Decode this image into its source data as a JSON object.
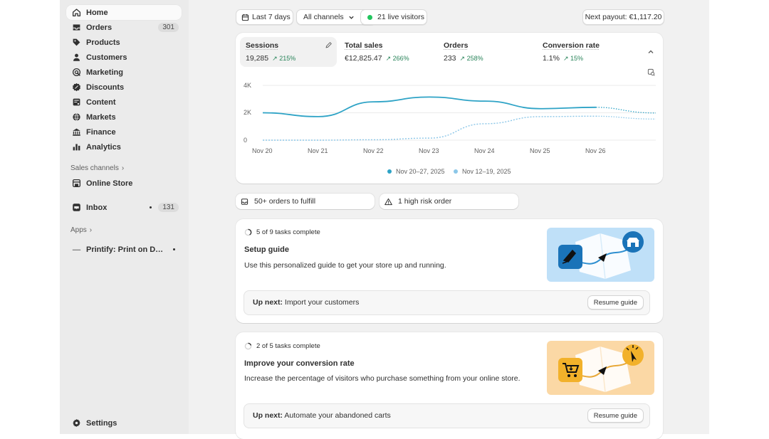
{
  "sidebar": {
    "items": [
      {
        "label": "Home",
        "icon": "home-icon",
        "active": true
      },
      {
        "label": "Orders",
        "icon": "orders-icon",
        "badge": "301"
      },
      {
        "label": "Products",
        "icon": "tag-icon"
      },
      {
        "label": "Customers",
        "icon": "person-icon"
      },
      {
        "label": "Marketing",
        "icon": "target-icon"
      },
      {
        "label": "Discounts",
        "icon": "discount-icon"
      },
      {
        "label": "Content",
        "icon": "content-icon"
      },
      {
        "label": "Markets",
        "icon": "globe-icon"
      },
      {
        "label": "Finance",
        "icon": "bank-icon"
      },
      {
        "label": "Analytics",
        "icon": "bar-chart-icon"
      }
    ],
    "sales_channels_label": "Sales channels",
    "online_store_label": "Online Store",
    "inbox_label": "Inbox",
    "inbox_badge": "131",
    "apps_label": "Apps",
    "printify_label": "Printify: Print on Dem...",
    "settings_label": "Settings"
  },
  "filters": {
    "date_range": "Last 7 days",
    "channels": "All channels",
    "live_visitors": "21 live visitors",
    "payout": "Next payout: €1,117.20"
  },
  "metrics": [
    {
      "label": "Sessions",
      "value": "19,285",
      "delta": "215%"
    },
    {
      "label": "Total sales",
      "value": "€12,825.47",
      "delta": "266%"
    },
    {
      "label": "Orders",
      "value": "233",
      "delta": "258%"
    },
    {
      "label": "Conversion rate",
      "value": "1.1%",
      "delta": "15%"
    }
  ],
  "chart_data": {
    "type": "line",
    "x": [
      "Nov 20",
      "Nov 21",
      "Nov 22",
      "Nov 23",
      "Nov 24",
      "Nov 25",
      "Nov 26"
    ],
    "yticks": [
      "4K",
      "2K",
      "0"
    ],
    "ylim": [
      0,
      4000
    ],
    "series": [
      {
        "name": "Nov 20–27, 2025",
        "color": "#2ea3c6",
        "style": "solid",
        "values": [
          2000,
          1720,
          2800,
          3150,
          2850,
          2300,
          2400
        ]
      },
      {
        "name": "Nov 12–19, 2025",
        "color": "#8cc7e8",
        "style": "dotted",
        "values": [
          0,
          0,
          30,
          150,
          1200,
          1720,
          1750
        ]
      }
    ]
  },
  "alerts": {
    "fulfill": "50+ orders to fulfill",
    "risk": "1 high risk order"
  },
  "tasks": [
    {
      "progress": "5 of 9 tasks complete",
      "title": "Setup guide",
      "desc": "Use this personalized guide to get your store up and running.",
      "upnext_label": "Up next:",
      "upnext_text": "Import your customers",
      "button": "Resume guide"
    },
    {
      "progress": "2 of 5 tasks complete",
      "title": "Improve your conversion rate",
      "desc": "Increase the percentage of visitors who purchase something from your online store.",
      "upnext_label": "Up next:",
      "upnext_text": "Automate your abandoned carts",
      "button": "Resume guide"
    }
  ],
  "colors": {
    "accent_positive": "#29845a",
    "live_dot": "#22c55e",
    "chart_primary": "#2ea3c6",
    "chart_secondary": "#8cc7e8",
    "illus_blue": "#bfe0f8",
    "illus_orange": "#fbd8a5"
  }
}
